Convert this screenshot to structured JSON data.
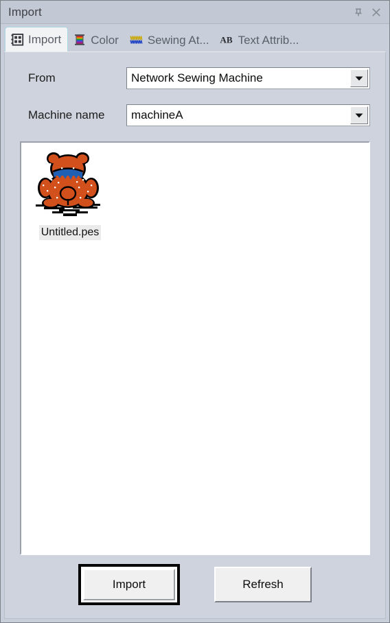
{
  "window": {
    "title": "Import",
    "pin_icon": "pin-icon",
    "close_icon": "close-icon"
  },
  "tabs": [
    {
      "label": "Import",
      "icon": "grid-table-icon",
      "active": true
    },
    {
      "label": "Color",
      "icon": "thread-spool-icon",
      "active": false
    },
    {
      "label": "Sewing At...",
      "icon": "stitches-icon",
      "active": false
    },
    {
      "label": "Text Attrib...",
      "icon": "ab-text-icon",
      "active": false
    }
  ],
  "form": {
    "from": {
      "label": "From",
      "value": "Network Sewing Machine",
      "arrow_icon": "chevron-down-icon"
    },
    "machine_name": {
      "label": "Machine name",
      "value": "machineA",
      "arrow_icon": "chevron-down-icon"
    }
  },
  "file_list": {
    "items": [
      {
        "name": "Untitled.pes",
        "thumbnail": "teddy-bear-embroidery",
        "selected": false
      }
    ]
  },
  "buttons": {
    "import": {
      "label": "Import",
      "is_default": true
    },
    "refresh": {
      "label": "Refresh",
      "is_default": false
    }
  },
  "colors": {
    "window_bg": "#c9cfda",
    "titlebar_bg": "#c3c9d4",
    "content_bg": "#ced3dd",
    "list_bg": "#ffffff",
    "bear_body": "#d2501b",
    "bear_collar": "#1f5fb4",
    "bear_outline": "#000000",
    "button_face": "#f0f0f0",
    "text": "#1c1c1c",
    "tab_text": "#5a5f68"
  }
}
